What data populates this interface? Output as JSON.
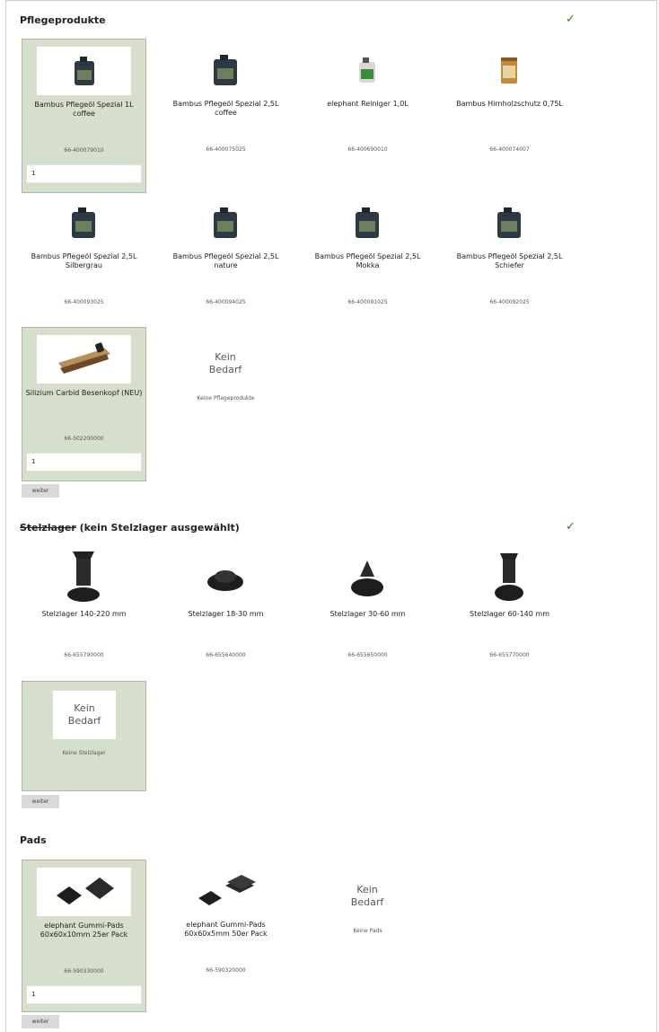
{
  "sections": {
    "pflege": {
      "title": "Pflegeprodukte",
      "check": "✓",
      "items": [
        {
          "name": "Bambus Pflegeöl Spezial 1L coffee",
          "sku": "66-400079010",
          "qty": "1",
          "icon": "oil-canister-icon"
        },
        {
          "name": "Bambus Pflegeöl Spezial 2,5L coffee",
          "sku": "66-400075025",
          "icon": "oil-canister-icon"
        },
        {
          "name": "elephant Reiniger 1,0L",
          "sku": "66-400690010",
          "icon": "cleaner-canister-icon"
        },
        {
          "name": "Bambus Hirnholzschutz 0,75L",
          "sku": "66-400074007",
          "icon": "wood-protection-can-icon"
        },
        {
          "name": "Bambus Pflegeöl Spezial 2,5L Silbergrau",
          "sku": "66-400093025",
          "icon": "oil-canister-icon"
        },
        {
          "name": "Bambus Pflegeöl Spezial 2,5L nature",
          "sku": "66-400094025",
          "icon": "oil-canister-icon"
        },
        {
          "name": "Bambus Pflegeöl Spezial 2,5L Mokka",
          "sku": "66-400091025",
          "icon": "oil-canister-icon"
        },
        {
          "name": "Bambus Pflegeöl Spezial 2,5L Schiefer",
          "sku": "66-400092025",
          "icon": "oil-canister-icon"
        },
        {
          "name": "Silizium Carbid Besenkopf (NEU)",
          "sku": "66-502200000",
          "qty": "1",
          "icon": "broom-head-icon"
        }
      ],
      "none": {
        "line1": "Kein",
        "line2": "Bedarf",
        "label": "Keine Pflegeprodukte"
      },
      "next": "weiter"
    },
    "stelz": {
      "title_struck": "Stelzlager",
      "title_rest": " (kein Stelzlager ausgewählt)",
      "check": "✓",
      "items": [
        {
          "name": "Stelzlager 140-220 mm",
          "sku": "66-655790000",
          "icon": "pedestal-tall-icon"
        },
        {
          "name": "Stelzlager 18-30 mm",
          "sku": "66-655640000",
          "icon": "pedestal-flat-icon"
        },
        {
          "name": "Stelzlager 30-60 mm",
          "sku": "66-655650000",
          "icon": "pedestal-medium-icon"
        },
        {
          "name": "Stelzlager 60-140 mm",
          "sku": "66-655770000",
          "icon": "pedestal-tall-icon"
        }
      ],
      "none": {
        "line1": "Kein",
        "line2": "Bedarf",
        "label": "Keine Stelzlager"
      },
      "next": "weiter"
    },
    "pads": {
      "title": "Pads",
      "items": [
        {
          "name": "elephant Gummi-Pads 60x60x10mm 25er Pack",
          "sku": "66-590330000",
          "qty": "1",
          "icon": "rubber-pads-icon"
        },
        {
          "name": "elephant Gummi-Pads 60x60x5mm 50er Pack",
          "sku": "66-590320000",
          "icon": "rubber-pads-stack-icon"
        }
      ],
      "none": {
        "line1": "Kein",
        "line2": "Bedarf",
        "label": "Keine Pads"
      },
      "next": "weiter"
    }
  },
  "colors": {
    "selected_bg": "#d6dfcc",
    "check": "#2e7d1a"
  }
}
